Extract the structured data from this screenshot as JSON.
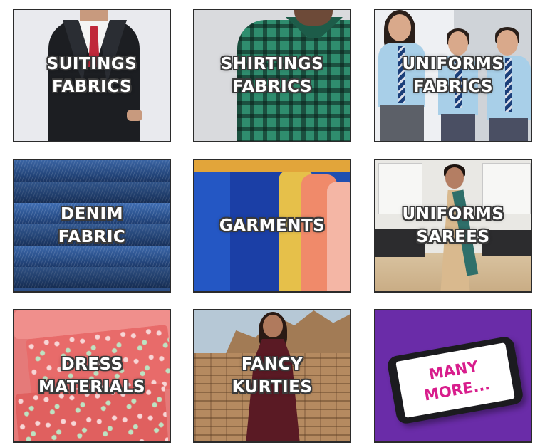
{
  "tiles": [
    {
      "id": "suitings",
      "lines": [
        "SUITINGS",
        "FABRICS"
      ]
    },
    {
      "id": "shirtings",
      "lines": [
        "SHIRTINGS",
        "FABRICS"
      ]
    },
    {
      "id": "uniforms-fabrics",
      "lines": [
        "UNIFORMS",
        "FABRICS"
      ]
    },
    {
      "id": "denim",
      "lines": [
        "DENIM",
        "FABRIC"
      ]
    },
    {
      "id": "garments",
      "lines": [
        "GARMENTS"
      ]
    },
    {
      "id": "uniforms-sarees",
      "lines": [
        "UNIFORMS",
        "SAREES"
      ]
    },
    {
      "id": "dress-materials",
      "lines": [
        "DRESS",
        "MATERIALS"
      ]
    },
    {
      "id": "fancy-kurties",
      "lines": [
        "FANCY",
        "KURTIES"
      ]
    },
    {
      "id": "many-more",
      "lines": [
        "MANY",
        "MORE..."
      ]
    }
  ],
  "colors": {
    "caption_text": "#ffffff",
    "caption_outline": "#3a3a3a",
    "many_more_bg": "#6a2ca8",
    "many_more_text": "#d81d8c"
  }
}
